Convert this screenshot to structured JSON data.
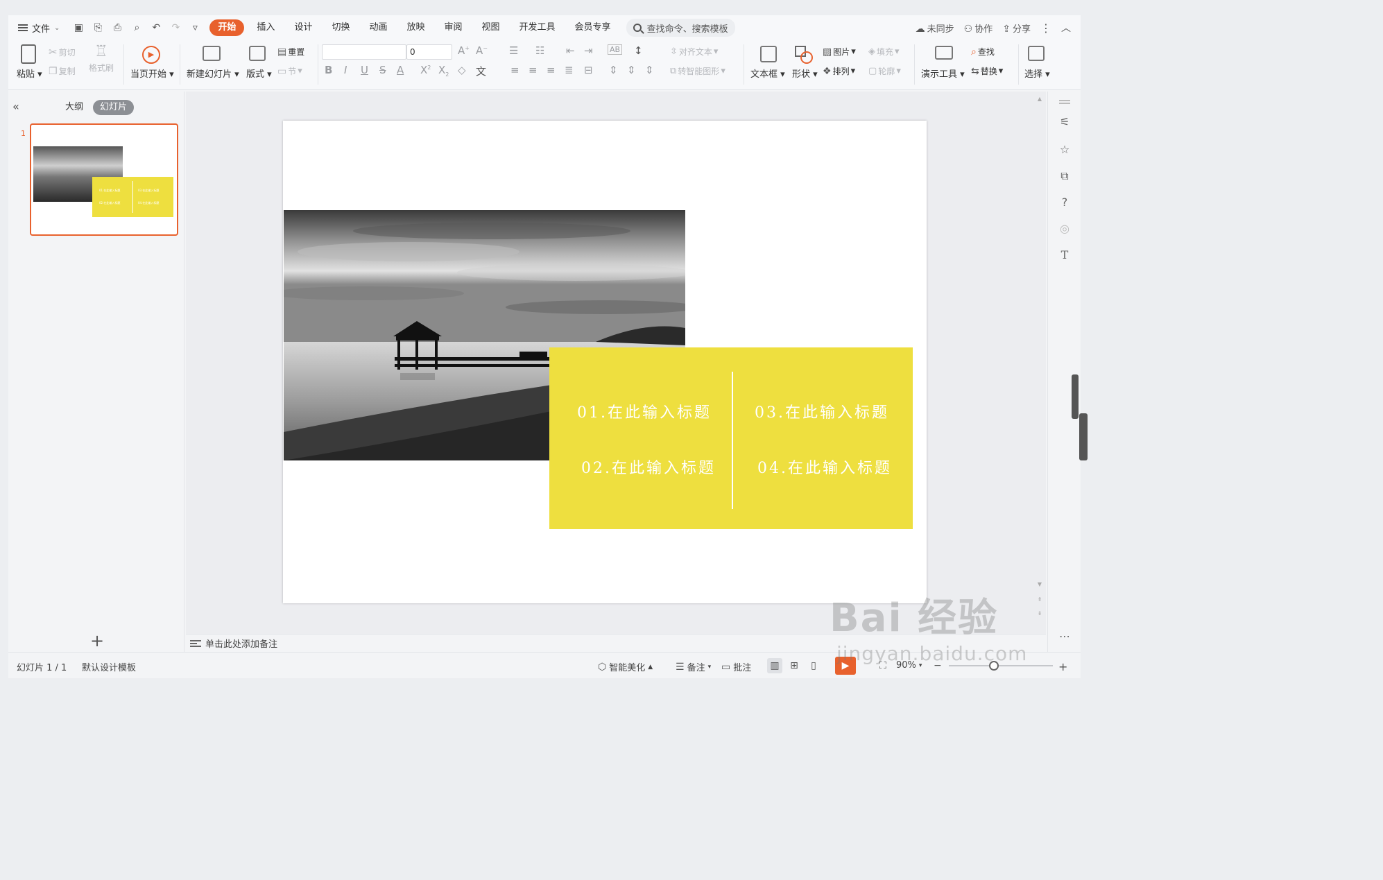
{
  "menubar": {
    "file_label": "文件",
    "tabs": [
      "开始",
      "插入",
      "设计",
      "切换",
      "动画",
      "放映",
      "审阅",
      "视图",
      "开发工具",
      "会员专享"
    ],
    "search_placeholder": "查找命令、搜索模板",
    "unsynced": "未同步",
    "collaborate": "协作",
    "share": "分享"
  },
  "ribbon": {
    "paste": "粘贴",
    "cut": "剪切",
    "copy": "复制",
    "format_painter": "格式刷",
    "play_from_current": "当页开始",
    "new_slide": "新建幻灯片",
    "layout": "版式",
    "reset": "重置",
    "section": "节",
    "font_size": "0",
    "align_text": "对齐文本",
    "smart_art": "转智能图形",
    "textbox": "文本框",
    "shape": "形状",
    "picture": "图片",
    "fill": "填充",
    "arrange": "排列",
    "outline": "轮廓",
    "presenter_tools": "演示工具",
    "find": "查找",
    "replace": "替换",
    "select": "选择"
  },
  "leftpanel": {
    "outline_tab": "大纲",
    "slides_tab": "幻灯片",
    "slide_number": "1",
    "thumb_titles": [
      "01.在此输入标题",
      "03.在此输入标题",
      "02.在此输入标题",
      "04.在此输入标题"
    ]
  },
  "slide": {
    "titles": {
      "t1": "01.在此输入标题",
      "t2": "02.在此输入标题",
      "t3": "03.在此输入标题",
      "t4": "04.在此输入标题"
    },
    "accent_color": "#eedf3f"
  },
  "notes": {
    "placeholder": "单击此处添加备注"
  },
  "status": {
    "slide_counter": "幻灯片 1 / 1",
    "template": "默认设计模板",
    "smart_beautify": "智能美化",
    "notes": "备注",
    "comments": "批注",
    "zoom": "90%"
  },
  "watermark": {
    "brand": "Bai 经验",
    "url": "jingyan.baidu.com"
  }
}
